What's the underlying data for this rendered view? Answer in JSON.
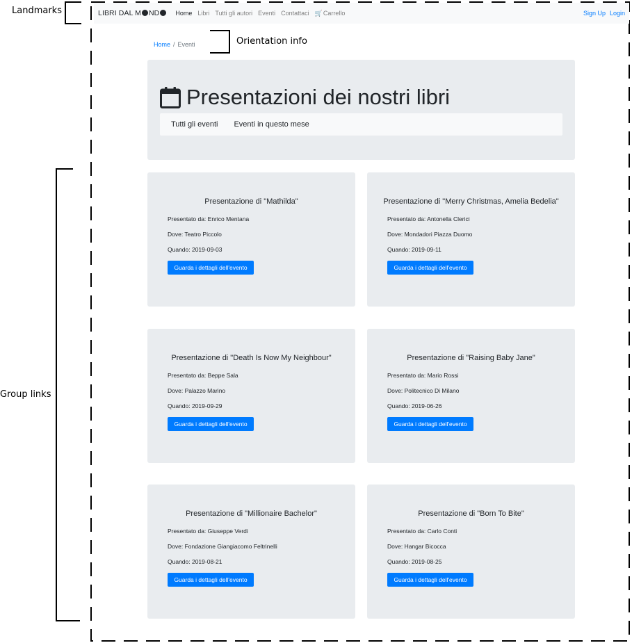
{
  "annotations": {
    "landmarks": "Landmarks",
    "orientation": "Orientation info",
    "group_links": "Group links"
  },
  "navbar": {
    "brand_prefix": "LIBRI DAL M",
    "brand_suffix": "ND",
    "items": [
      {
        "label": "Home",
        "active": true
      },
      {
        "label": "Libri"
      },
      {
        "label": "Tutti gli autori"
      },
      {
        "label": "Eventi"
      },
      {
        "label": "Contattaci"
      },
      {
        "label": "Carrello",
        "icon": "cart-icon"
      }
    ],
    "signup": "Sign Up",
    "login": "Login"
  },
  "breadcrumb": {
    "home": "Home",
    "separator": "/",
    "current": "Eventi"
  },
  "jumbotron": {
    "icon": "calendar-icon",
    "title": "Presentazioni dei nostri libri",
    "tabs": [
      "Tutti gli eventi",
      "Eventi in questo mese"
    ]
  },
  "events": [
    {
      "title": "Presentazione di \"Mathilda\"",
      "presenter": "Presentato da: Enrico Mentana",
      "where": "Dove: Teatro Piccolo",
      "when": "Quando: 2019-09-03",
      "button": "Guarda i dettagli dell'evento"
    },
    {
      "title": "Presentazione di \"Merry Christmas, Amelia Bedelia\"",
      "presenter": "Presentato da: Antonella Clerici",
      "where": "Dove: Mondadori Piazza Duomo",
      "when": "Quando: 2019-09-11",
      "button": "Guarda i dettagli dell'evento"
    },
    {
      "title": "Presentazione di \"Death Is Now My Neighbour\"",
      "presenter": "Presentato da: Beppe Sala",
      "where": "Dove: Palazzo Marino",
      "when": "Quando: 2019-09-29",
      "button": "Guarda i dettagli dell'evento"
    },
    {
      "title": "Presentazione di \"Raising Baby Jane\"",
      "presenter": "Presentato da: Mario Rossi",
      "where": "Dove: Politecnico Di Milano",
      "when": "Quando: 2019-06-26",
      "button": "Guarda i dettagli dell'evento"
    },
    {
      "title": "Presentazione di \"Millionaire Bachelor\"",
      "presenter": "Presentato da: Giuseppe Verdi",
      "where": "Dove: Fondazione Giangiacomo Feltrinelli",
      "when": "Quando: 2019-08-21",
      "button": "Guarda i dettagli dell'evento"
    },
    {
      "title": "Presentazione di \"Born To Bite\"",
      "presenter": "Presentato da: Carlo Conti",
      "where": "Dove: Hangar Bicocca",
      "when": "Quando: 2019-08-25",
      "button": "Guarda i dettagli dell'evento"
    }
  ],
  "colors": {
    "link": "#007bff",
    "panel": "#e9ecef",
    "navbar": "#f8f9fa"
  }
}
